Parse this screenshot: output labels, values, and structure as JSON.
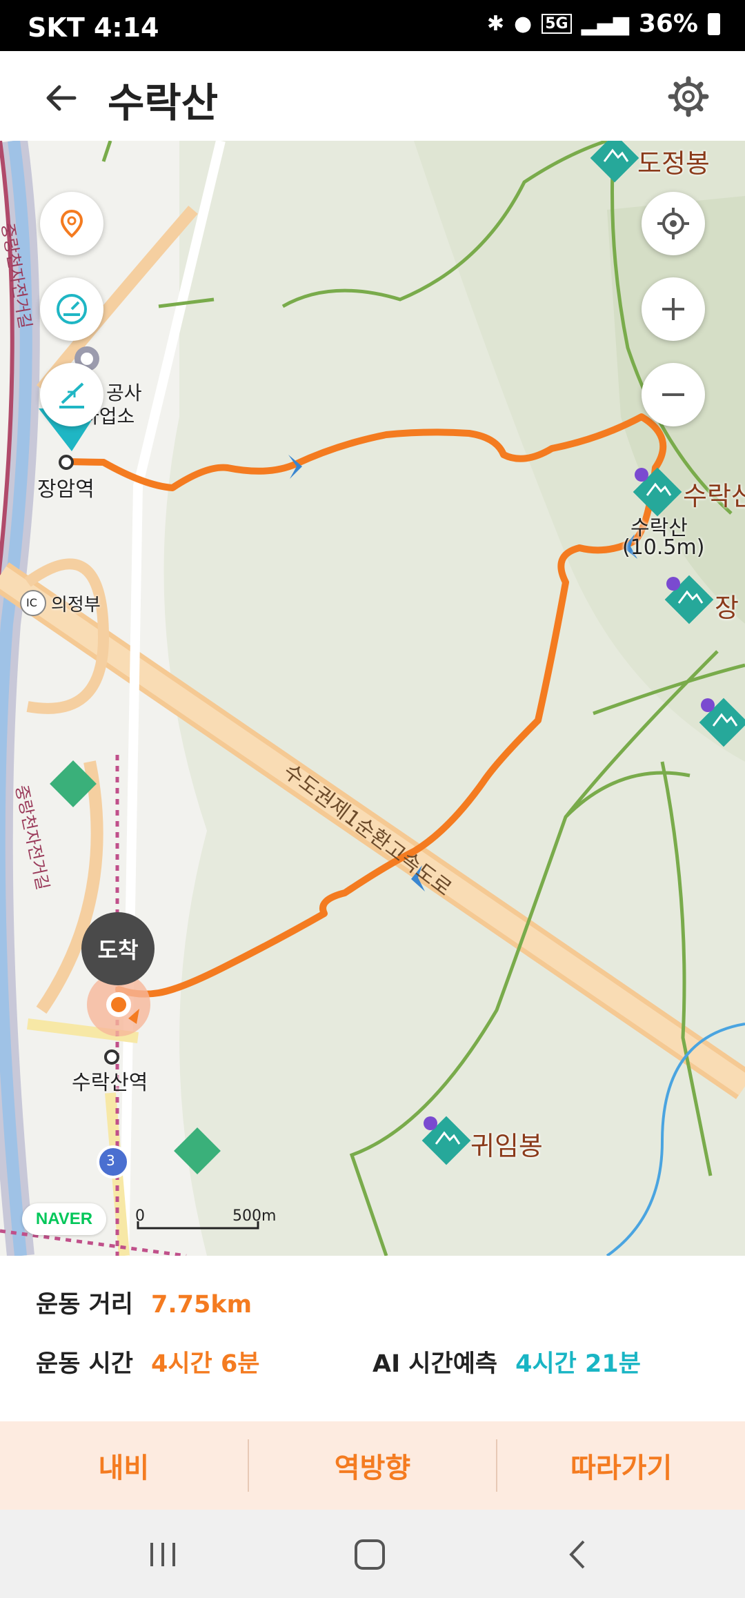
{
  "status_bar": {
    "carrier_time": "SKT 4:14",
    "network": "5G",
    "battery": "36%"
  },
  "header": {
    "title": "수락산",
    "back_icon": "arrow-left-icon",
    "settings_icon": "gear-icon"
  },
  "map": {
    "station_labels": [
      "장암역",
      "수락산역"
    ],
    "place_labels": [
      "의정부",
      "공사",
      "사업소"
    ],
    "peaks": [
      {
        "name": "도정봉"
      },
      {
        "name": "수락산"
      },
      {
        "name": "장"
      },
      {
        "name": "귀임봉"
      }
    ],
    "summit_label": "수락산",
    "summit_elevation": "(10.5m)",
    "road_label": "수도권제1순환고속도로",
    "bike_path_label": "중랑천자전거길",
    "ic_badge": "IC",
    "route_badge": "3",
    "arrival_label": "도착",
    "brand": "NAVER",
    "scale_zero": "0",
    "scale_distance": "500m",
    "route_color": "#f47b20",
    "accent_color": "#19b5c4"
  },
  "stats": {
    "distance_label": "운동 거리",
    "distance_value": "7.75km",
    "time_label": "운동 시간",
    "time_value": "4시간 6분",
    "ai_label": "AI 시간예측",
    "ai_value": "4시간 21분"
  },
  "actions": {
    "navi": "내비",
    "reverse": "역방향",
    "follow": "따라가기"
  }
}
